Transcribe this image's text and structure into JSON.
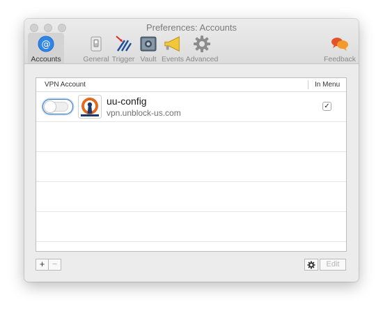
{
  "window": {
    "title": "Preferences: Accounts"
  },
  "toolbar": {
    "items": [
      {
        "label": "Accounts",
        "icon": "at-icon"
      },
      {
        "label": "General",
        "icon": "switch-icon"
      },
      {
        "label": "Trigger",
        "icon": "trigger-icon"
      },
      {
        "label": "Vault",
        "icon": "vault-icon"
      },
      {
        "label": "Events",
        "icon": "megaphone-icon"
      },
      {
        "label": "Advanced",
        "icon": "gear-icon"
      },
      {
        "label": "Feedback",
        "icon": "chat-bubbles-icon"
      }
    ],
    "active": "Accounts"
  },
  "table": {
    "headers": {
      "account": "VPN Account",
      "in_menu": "In Menu"
    },
    "rows": [
      {
        "name": "uu-config",
        "server": "vpn.unblock-us.com",
        "in_menu": "✓",
        "connected": false
      }
    ]
  },
  "footer": {
    "add_label": "+",
    "remove_label": "−",
    "settings_icon": "gear-icon",
    "edit_label": "Edit"
  },
  "colors": {
    "accent": "#3b7fc4",
    "openvpn_orange": "#e06b1f",
    "openvpn_navy": "#1b3a6b"
  }
}
